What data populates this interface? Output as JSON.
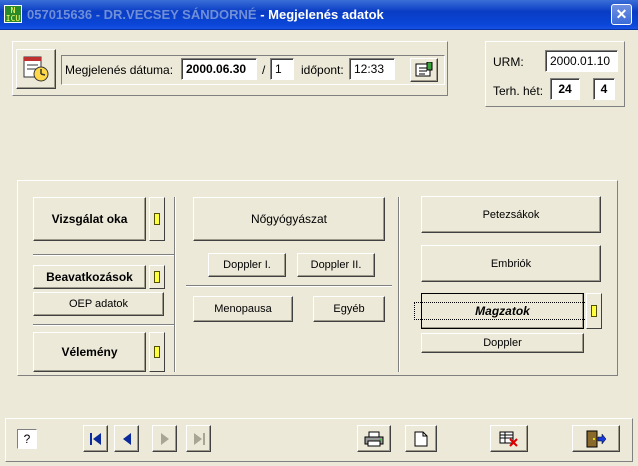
{
  "window": {
    "patient_id": "057015636",
    "doctor_name": "DR.VECSEY SÁNDORNÉ",
    "title": "Megjelenés adatok",
    "close_glyph": "✕"
  },
  "appearance": {
    "date_label": "Megjelenés dátuma:",
    "date_value": "2000.06.30",
    "slash": "/",
    "sequence_value": "1",
    "time_label": "időpont:",
    "time_value": "12:33"
  },
  "urm": {
    "urm_label": "URM:",
    "urm_value": "2000.01.10",
    "week_label": "Terh. hét:",
    "week_value": "24",
    "day_value": "4"
  },
  "left_buttons": {
    "vizsgalat": "Vizsgálat oka",
    "beavatkozasok": "Beavatkozások",
    "oep": "OEP adatok",
    "velemeny": "Vélemény"
  },
  "middle_buttons": {
    "nogyogyaszat": "Nőgyógyászat",
    "doppler1": "Doppler I.",
    "doppler2": "Doppler II.",
    "menopausa": "Menopausa",
    "egyeb": "Egyéb"
  },
  "right_buttons": {
    "petezsakok": "Petezsákok",
    "embriok": "Embriók",
    "magzatok": "Magzatok",
    "doppler": "Doppler"
  },
  "toolbar": {
    "help": "?"
  },
  "colors": {
    "title_bar": "#0a3cc4",
    "window_bg": "#ece9d8",
    "indicator": "#ffff40",
    "nav_arrow": "#0a2a9c"
  },
  "icons": [
    "app-icon",
    "calendar-clock-icon",
    "notes-icon",
    "first-record-icon",
    "prev-record-icon",
    "next-record-icon",
    "last-record-icon",
    "print-icon",
    "new-page-icon",
    "delete-record-icon",
    "exit-door-icon"
  ]
}
